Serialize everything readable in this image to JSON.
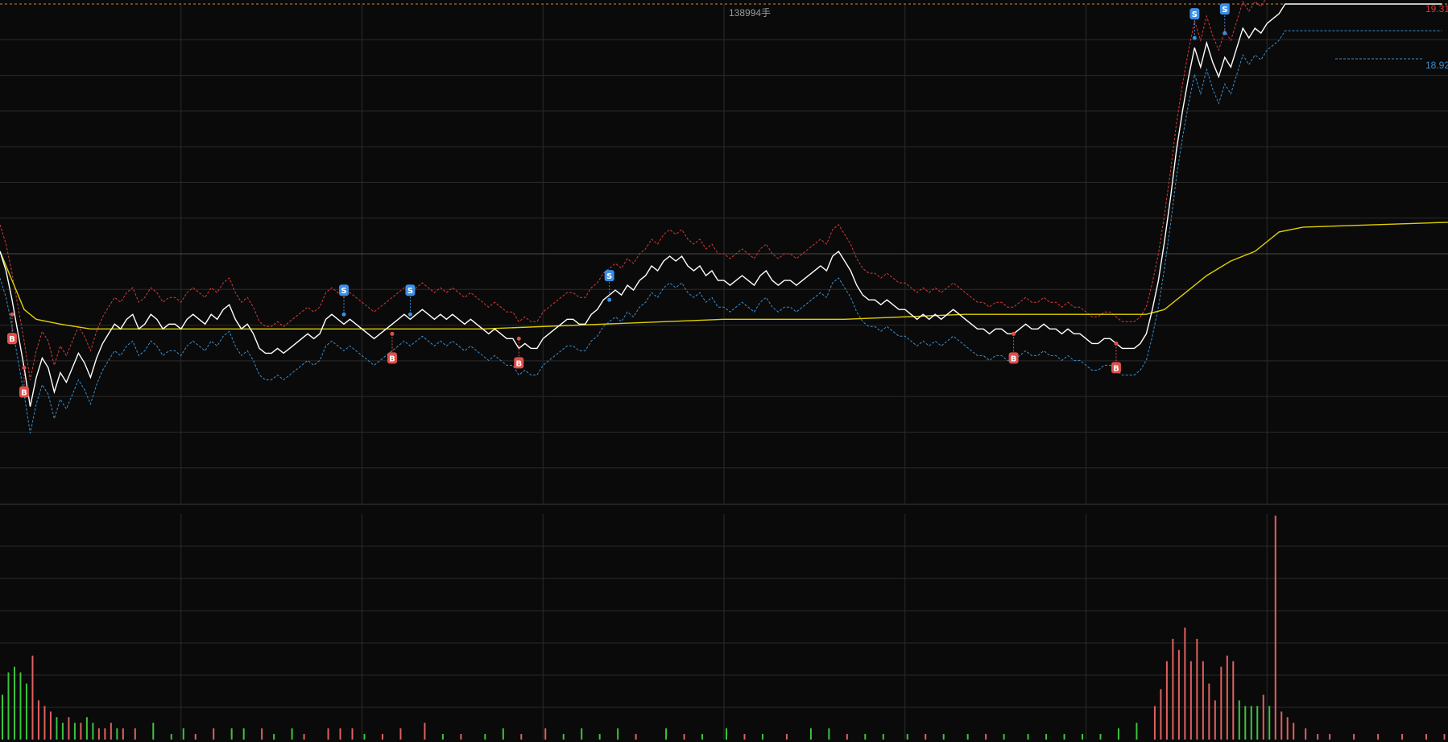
{
  "chart_data": {
    "type": "line",
    "title": "",
    "xlabel": "",
    "ylabel": "",
    "ylim": [
      18.32,
      19.35
    ],
    "grid": true,
    "volume_peak_label": "138994手",
    "right_labels": {
      "top": "19.31",
      "line2": "18.92"
    },
    "colors": {
      "background": "#0a0a0a",
      "grid": "#2a2a2a",
      "price": "#ffffff",
      "avg": "#e0d000",
      "upper_band": "#d63a3a",
      "lower_band": "#3a8fd0",
      "vol_up": "#e06060",
      "vol_down": "#3cc43c",
      "buy_marker": "#e0504a",
      "sell_marker": "#3a8fe6",
      "top_line": "#d6883a"
    },
    "x_range": [
      0,
      240
    ],
    "price": [
      [
        0,
        18.84
      ],
      [
        1,
        18.8
      ],
      [
        2,
        18.74
      ],
      [
        3,
        18.67
      ],
      [
        4,
        18.6
      ],
      [
        5,
        18.52
      ],
      [
        6,
        18.58
      ],
      [
        7,
        18.62
      ],
      [
        8,
        18.6
      ],
      [
        9,
        18.55
      ],
      [
        10,
        18.59
      ],
      [
        11,
        18.57
      ],
      [
        12,
        18.6
      ],
      [
        13,
        18.63
      ],
      [
        14,
        18.61
      ],
      [
        15,
        18.58
      ],
      [
        16,
        18.62
      ],
      [
        17,
        18.65
      ],
      [
        18,
        18.67
      ],
      [
        19,
        18.69
      ],
      [
        20,
        18.68
      ],
      [
        21,
        18.7
      ],
      [
        22,
        18.71
      ],
      [
        23,
        18.68
      ],
      [
        24,
        18.69
      ],
      [
        25,
        18.71
      ],
      [
        26,
        18.7
      ],
      [
        27,
        18.68
      ],
      [
        28,
        18.69
      ],
      [
        29,
        18.69
      ],
      [
        30,
        18.68
      ],
      [
        31,
        18.7
      ],
      [
        32,
        18.71
      ],
      [
        33,
        18.7
      ],
      [
        34,
        18.69
      ],
      [
        35,
        18.71
      ],
      [
        36,
        18.7
      ],
      [
        37,
        18.72
      ],
      [
        38,
        18.73
      ],
      [
        39,
        18.7
      ],
      [
        40,
        18.68
      ],
      [
        41,
        18.69
      ],
      [
        42,
        18.67
      ],
      [
        43,
        18.64
      ],
      [
        44,
        18.63
      ],
      [
        45,
        18.63
      ],
      [
        46,
        18.64
      ],
      [
        47,
        18.63
      ],
      [
        48,
        18.64
      ],
      [
        49,
        18.65
      ],
      [
        50,
        18.66
      ],
      [
        51,
        18.67
      ],
      [
        52,
        18.66
      ],
      [
        53,
        18.67
      ],
      [
        54,
        18.7
      ],
      [
        55,
        18.71
      ],
      [
        56,
        18.7
      ],
      [
        57,
        18.69
      ],
      [
        58,
        18.7
      ],
      [
        59,
        18.69
      ],
      [
        60,
        18.68
      ],
      [
        61,
        18.67
      ],
      [
        62,
        18.66
      ],
      [
        63,
        18.67
      ],
      [
        64,
        18.68
      ],
      [
        65,
        18.69
      ],
      [
        66,
        18.7
      ],
      [
        67,
        18.71
      ],
      [
        68,
        18.7
      ],
      [
        69,
        18.71
      ],
      [
        70,
        18.72
      ],
      [
        71,
        18.71
      ],
      [
        72,
        18.7
      ],
      [
        73,
        18.71
      ],
      [
        74,
        18.7
      ],
      [
        75,
        18.71
      ],
      [
        76,
        18.7
      ],
      [
        77,
        18.69
      ],
      [
        78,
        18.7
      ],
      [
        79,
        18.69
      ],
      [
        80,
        18.68
      ],
      [
        81,
        18.67
      ],
      [
        82,
        18.68
      ],
      [
        83,
        18.67
      ],
      [
        84,
        18.66
      ],
      [
        85,
        18.66
      ],
      [
        86,
        18.64
      ],
      [
        87,
        18.65
      ],
      [
        88,
        18.64
      ],
      [
        89,
        18.64
      ],
      [
        90,
        18.66
      ],
      [
        91,
        18.67
      ],
      [
        92,
        18.68
      ],
      [
        93,
        18.69
      ],
      [
        94,
        18.7
      ],
      [
        95,
        18.7
      ],
      [
        96,
        18.69
      ],
      [
        97,
        18.69
      ],
      [
        98,
        18.71
      ],
      [
        99,
        18.72
      ],
      [
        100,
        18.74
      ],
      [
        101,
        18.75
      ],
      [
        102,
        18.76
      ],
      [
        103,
        18.75
      ],
      [
        104,
        18.77
      ],
      [
        105,
        18.76
      ],
      [
        106,
        18.78
      ],
      [
        107,
        18.79
      ],
      [
        108,
        18.81
      ],
      [
        109,
        18.8
      ],
      [
        110,
        18.82
      ],
      [
        111,
        18.83
      ],
      [
        112,
        18.82
      ],
      [
        113,
        18.83
      ],
      [
        114,
        18.81
      ],
      [
        115,
        18.8
      ],
      [
        116,
        18.81
      ],
      [
        117,
        18.79
      ],
      [
        118,
        18.8
      ],
      [
        119,
        18.78
      ],
      [
        120,
        18.78
      ],
      [
        121,
        18.77
      ],
      [
        122,
        18.78
      ],
      [
        123,
        18.79
      ],
      [
        124,
        18.78
      ],
      [
        125,
        18.77
      ],
      [
        126,
        18.79
      ],
      [
        127,
        18.8
      ],
      [
        128,
        18.78
      ],
      [
        129,
        18.77
      ],
      [
        130,
        18.78
      ],
      [
        131,
        18.78
      ],
      [
        132,
        18.77
      ],
      [
        133,
        18.78
      ],
      [
        134,
        18.79
      ],
      [
        135,
        18.8
      ],
      [
        136,
        18.81
      ],
      [
        137,
        18.8
      ],
      [
        138,
        18.83
      ],
      [
        139,
        18.84
      ],
      [
        140,
        18.82
      ],
      [
        141,
        18.8
      ],
      [
        142,
        18.77
      ],
      [
        143,
        18.75
      ],
      [
        144,
        18.74
      ],
      [
        145,
        18.74
      ],
      [
        146,
        18.73
      ],
      [
        147,
        18.74
      ],
      [
        148,
        18.73
      ],
      [
        149,
        18.72
      ],
      [
        150,
        18.72
      ],
      [
        151,
        18.71
      ],
      [
        152,
        18.7
      ],
      [
        153,
        18.71
      ],
      [
        154,
        18.7
      ],
      [
        155,
        18.71
      ],
      [
        156,
        18.7
      ],
      [
        157,
        18.71
      ],
      [
        158,
        18.72
      ],
      [
        159,
        18.71
      ],
      [
        160,
        18.7
      ],
      [
        161,
        18.69
      ],
      [
        162,
        18.68
      ],
      [
        163,
        18.68
      ],
      [
        164,
        18.67
      ],
      [
        165,
        18.68
      ],
      [
        166,
        18.68
      ],
      [
        167,
        18.67
      ],
      [
        168,
        18.67
      ],
      [
        169,
        18.68
      ],
      [
        170,
        18.69
      ],
      [
        171,
        18.68
      ],
      [
        172,
        18.68
      ],
      [
        173,
        18.69
      ],
      [
        174,
        18.68
      ],
      [
        175,
        18.68
      ],
      [
        176,
        18.67
      ],
      [
        177,
        18.68
      ],
      [
        178,
        18.67
      ],
      [
        179,
        18.67
      ],
      [
        180,
        18.66
      ],
      [
        181,
        18.65
      ],
      [
        182,
        18.65
      ],
      [
        183,
        18.66
      ],
      [
        184,
        18.66
      ],
      [
        185,
        18.65
      ],
      [
        186,
        18.64
      ],
      [
        187,
        18.64
      ],
      [
        188,
        18.64
      ],
      [
        189,
        18.65
      ],
      [
        190,
        18.67
      ],
      [
        191,
        18.72
      ],
      [
        192,
        18.78
      ],
      [
        193,
        18.86
      ],
      [
        194,
        18.95
      ],
      [
        195,
        19.05
      ],
      [
        196,
        19.13
      ],
      [
        197,
        19.2
      ],
      [
        198,
        19.26
      ],
      [
        199,
        19.22
      ],
      [
        200,
        19.27
      ],
      [
        201,
        19.23
      ],
      [
        202,
        19.2
      ],
      [
        203,
        19.24
      ],
      [
        204,
        19.22
      ],
      [
        205,
        19.26
      ],
      [
        206,
        19.3
      ],
      [
        207,
        19.28
      ],
      [
        208,
        19.3
      ],
      [
        209,
        19.29
      ],
      [
        210,
        19.31
      ],
      [
        211,
        19.32
      ],
      [
        212,
        19.33
      ],
      [
        213,
        19.35
      ],
      [
        214,
        19.35
      ],
      [
        215,
        19.35
      ],
      [
        216,
        19.35
      ],
      [
        217,
        19.35
      ],
      [
        218,
        19.35
      ],
      [
        219,
        19.35
      ],
      [
        220,
        19.35
      ],
      [
        221,
        19.35
      ],
      [
        222,
        19.35
      ],
      [
        223,
        19.35
      ],
      [
        224,
        19.35
      ],
      [
        225,
        19.35
      ],
      [
        226,
        19.35
      ],
      [
        227,
        19.35
      ],
      [
        228,
        19.35
      ],
      [
        229,
        19.35
      ],
      [
        230,
        19.35
      ],
      [
        231,
        19.35
      ],
      [
        232,
        19.35
      ],
      [
        233,
        19.35
      ],
      [
        234,
        19.35
      ],
      [
        235,
        19.35
      ],
      [
        236,
        19.35
      ],
      [
        237,
        19.35
      ],
      [
        238,
        19.35
      ],
      [
        239,
        19.35
      ]
    ],
    "avg": [
      [
        0,
        18.84
      ],
      [
        2,
        18.78
      ],
      [
        4,
        18.72
      ],
      [
        6,
        18.7
      ],
      [
        10,
        18.69
      ],
      [
        15,
        18.68
      ],
      [
        20,
        18.68
      ],
      [
        30,
        18.68
      ],
      [
        40,
        18.68
      ],
      [
        60,
        18.68
      ],
      [
        80,
        18.68
      ],
      [
        100,
        18.69
      ],
      [
        120,
        18.7
      ],
      [
        140,
        18.7
      ],
      [
        160,
        18.71
      ],
      [
        180,
        18.71
      ],
      [
        190,
        18.71
      ],
      [
        193,
        18.72
      ],
      [
        196,
        18.75
      ],
      [
        200,
        18.79
      ],
      [
        204,
        18.82
      ],
      [
        208,
        18.84
      ],
      [
        210,
        18.86
      ],
      [
        212,
        18.88
      ],
      [
        216,
        18.89
      ],
      [
        240,
        18.9
      ]
    ],
    "band_offset": 0.055,
    "signals": [
      {
        "type": "B",
        "x": 2,
        "price": 18.71
      },
      {
        "type": "B",
        "x": 4,
        "price": 18.6
      },
      {
        "type": "S",
        "x": 57,
        "price": 18.71
      },
      {
        "type": "B",
        "x": 65,
        "price": 18.67
      },
      {
        "type": "S",
        "x": 68,
        "price": 18.71
      },
      {
        "type": "B",
        "x": 86,
        "price": 18.66
      },
      {
        "type": "S",
        "x": 101,
        "price": 18.74
      },
      {
        "type": "B",
        "x": 168,
        "price": 18.67
      },
      {
        "type": "B",
        "x": 185,
        "price": 18.65
      },
      {
        "type": "S",
        "x": 198,
        "price": 19.28
      },
      {
        "type": "S",
        "x": 203,
        "price": 19.29
      }
    ],
    "volume": [
      [
        0,
        8,
        "down"
      ],
      [
        1,
        12,
        "down"
      ],
      [
        2,
        13,
        "down"
      ],
      [
        3,
        12,
        "down"
      ],
      [
        4,
        10,
        "down"
      ],
      [
        5,
        15,
        "up"
      ],
      [
        6,
        7,
        "up"
      ],
      [
        7,
        6,
        "up"
      ],
      [
        8,
        5,
        "up"
      ],
      [
        9,
        4,
        "down"
      ],
      [
        10,
        3,
        "down"
      ],
      [
        11,
        4,
        "up"
      ],
      [
        12,
        3,
        "down"
      ],
      [
        13,
        3,
        "up"
      ],
      [
        14,
        4,
        "down"
      ],
      [
        15,
        3,
        "down"
      ],
      [
        16,
        2,
        "up"
      ],
      [
        17,
        2,
        "up"
      ],
      [
        18,
        3,
        "up"
      ],
      [
        19,
        2,
        "down"
      ],
      [
        20,
        2,
        "up"
      ],
      [
        22,
        2,
        "up"
      ],
      [
        25,
        3,
        "down"
      ],
      [
        28,
        1,
        "down"
      ],
      [
        30,
        2,
        "down"
      ],
      [
        32,
        1,
        "up"
      ],
      [
        35,
        2,
        "up"
      ],
      [
        38,
        2,
        "down"
      ],
      [
        40,
        2,
        "down"
      ],
      [
        43,
        2,
        "up"
      ],
      [
        45,
        1,
        "down"
      ],
      [
        48,
        2,
        "down"
      ],
      [
        50,
        1,
        "up"
      ],
      [
        54,
        2,
        "up"
      ],
      [
        56,
        2,
        "up"
      ],
      [
        58,
        2,
        "up"
      ],
      [
        60,
        1,
        "down"
      ],
      [
        63,
        1,
        "up"
      ],
      [
        66,
        2,
        "up"
      ],
      [
        70,
        3,
        "up"
      ],
      [
        73,
        1,
        "down"
      ],
      [
        76,
        1,
        "up"
      ],
      [
        80,
        1,
        "down"
      ],
      [
        83,
        2,
        "down"
      ],
      [
        86,
        1,
        "up"
      ],
      [
        90,
        2,
        "up"
      ],
      [
        93,
        1,
        "down"
      ],
      [
        96,
        2,
        "down"
      ],
      [
        99,
        1,
        "down"
      ],
      [
        102,
        2,
        "down"
      ],
      [
        105,
        1,
        "up"
      ],
      [
        110,
        2,
        "down"
      ],
      [
        113,
        1,
        "up"
      ],
      [
        116,
        1,
        "down"
      ],
      [
        120,
        2,
        "down"
      ],
      [
        123,
        1,
        "up"
      ],
      [
        126,
        1,
        "down"
      ],
      [
        130,
        1,
        "up"
      ],
      [
        134,
        2,
        "down"
      ],
      [
        137,
        2,
        "down"
      ],
      [
        140,
        1,
        "up"
      ],
      [
        143,
        1,
        "down"
      ],
      [
        146,
        1,
        "down"
      ],
      [
        150,
        1,
        "down"
      ],
      [
        153,
        1,
        "up"
      ],
      [
        156,
        1,
        "down"
      ],
      [
        160,
        1,
        "down"
      ],
      [
        163,
        1,
        "up"
      ],
      [
        166,
        1,
        "down"
      ],
      [
        170,
        1,
        "down"
      ],
      [
        173,
        1,
        "down"
      ],
      [
        176,
        1,
        "down"
      ],
      [
        179,
        1,
        "down"
      ],
      [
        182,
        1,
        "down"
      ],
      [
        185,
        2,
        "down"
      ],
      [
        188,
        3,
        "down"
      ],
      [
        191,
        6,
        "up"
      ],
      [
        192,
        9,
        "up"
      ],
      [
        193,
        14,
        "up"
      ],
      [
        194,
        18,
        "up"
      ],
      [
        195,
        16,
        "up"
      ],
      [
        196,
        20,
        "up"
      ],
      [
        197,
        14,
        "up"
      ],
      [
        198,
        18,
        "up"
      ],
      [
        199,
        14,
        "up"
      ],
      [
        200,
        10,
        "up"
      ],
      [
        201,
        7,
        "up"
      ],
      [
        202,
        13,
        "up"
      ],
      [
        203,
        15,
        "up"
      ],
      [
        204,
        14,
        "up"
      ],
      [
        205,
        7,
        "down"
      ],
      [
        206,
        6,
        "down"
      ],
      [
        207,
        6,
        "down"
      ],
      [
        208,
        6,
        "down"
      ],
      [
        209,
        8,
        "up"
      ],
      [
        210,
        6,
        "down"
      ],
      [
        211,
        40,
        "up"
      ],
      [
        212,
        5,
        "up"
      ],
      [
        213,
        4,
        "up"
      ],
      [
        214,
        3,
        "up"
      ],
      [
        216,
        2,
        "up"
      ],
      [
        218,
        1,
        "up"
      ],
      [
        220,
        1,
        "up"
      ],
      [
        224,
        1,
        "up"
      ],
      [
        228,
        1,
        "up"
      ],
      [
        232,
        1,
        "up"
      ],
      [
        236,
        1,
        "up"
      ],
      [
        239,
        1,
        "up"
      ]
    ]
  }
}
